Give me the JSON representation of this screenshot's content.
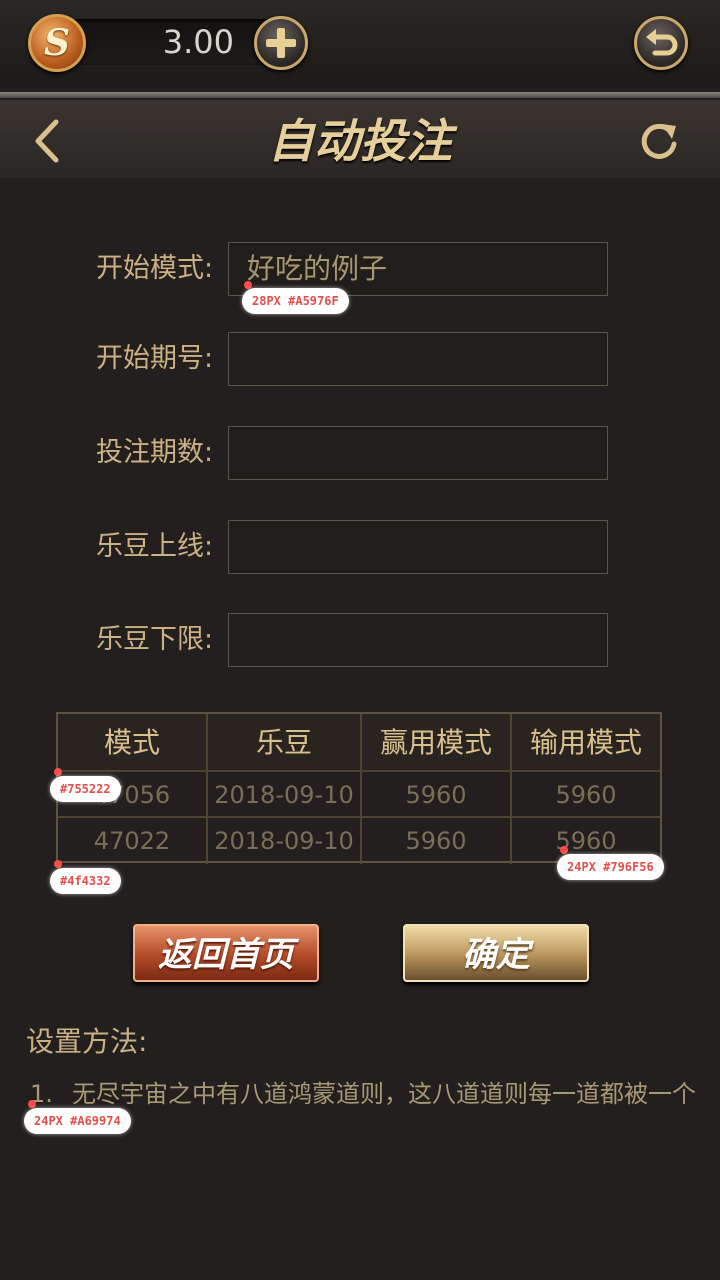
{
  "topbar": {
    "coin_symbol": "S",
    "coin_value": "3.00"
  },
  "header": {
    "title": "自动投注"
  },
  "form": {
    "fields": [
      {
        "label": "开始模式:",
        "value": "好吃的例子"
      },
      {
        "label": "开始期号:",
        "value": ""
      },
      {
        "label": "投注期数:",
        "value": ""
      },
      {
        "label": "乐豆上线:",
        "value": ""
      },
      {
        "label": "乐豆下限:",
        "value": ""
      }
    ]
  },
  "table": {
    "headers": [
      "模式",
      "乐豆",
      "赢用模式",
      "输用模式"
    ],
    "rows": [
      [
        "47056",
        "2018-09-10",
        "5960",
        "5960"
      ],
      [
        "47022",
        "2018-09-10",
        "5960",
        "5960"
      ]
    ]
  },
  "buttons": {
    "home": "返回首页",
    "confirm": "确定"
  },
  "howto": {
    "title": "设置方法:",
    "item_number": "1.",
    "item_text": "无尽宇宙之中有八道鸿蒙道则，这八道道则每一道都被一个"
  },
  "annotations": {
    "input_font": "28PX #A5976F",
    "header_bg": "#755222",
    "table_border": "#4f4332",
    "table_text": "24PX #796F56",
    "howto_text": "24PX #A69974"
  },
  "colors": {
    "background": "#231f1e",
    "input_text": "#A5976F",
    "table_text": "#796F56",
    "table_border": "#4f4332",
    "howto_text": "#A69974"
  }
}
